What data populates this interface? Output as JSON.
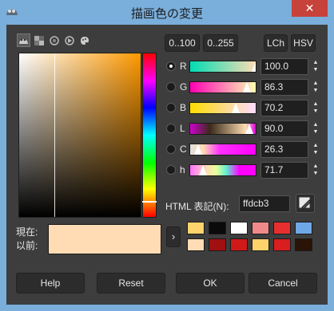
{
  "window": {
    "title": "描画色の変更",
    "close_glyph": "✕"
  },
  "tabs": [
    {
      "icon": "gimp-wilber-icon"
    },
    {
      "icon": "cmyk-selector-icon"
    },
    {
      "icon": "watercolor-icon"
    },
    {
      "icon": "wheel-icon"
    },
    {
      "icon": "palette-icon"
    }
  ],
  "range_buttons": {
    "range100": "0..100",
    "range255": "0..255"
  },
  "mode_buttons": {
    "lch": "LCh",
    "hsv": "HSV"
  },
  "channels": [
    {
      "key": "R",
      "label": "R",
      "value": "100.0",
      "selected": true,
      "marker_pct": 100
    },
    {
      "key": "G",
      "label": "G",
      "value": "86.3",
      "selected": false,
      "marker_pct": 86
    },
    {
      "key": "B",
      "label": "B",
      "value": "70.2",
      "selected": false,
      "marker_pct": 70
    },
    {
      "key": "L",
      "label": "L",
      "value": "90.0",
      "selected": false,
      "marker_pct": 90
    },
    {
      "key": "C",
      "label": "C",
      "value": "26.3",
      "selected": false,
      "marker_pct": 12
    },
    {
      "key": "h",
      "label": "h",
      "value": "71.7",
      "selected": false,
      "marker_pct": 20
    }
  ],
  "html_notation": {
    "label": "HTML 表記(N):",
    "value": "ffdcb3"
  },
  "color_preview": {
    "current_label": "現在:",
    "previous_label": "以前:",
    "current_color": "#ffdcb3"
  },
  "arrow_glyph": "›",
  "history": [
    "#ffd36b",
    "#0a0a0a",
    "#ffffff",
    "#f08a8a",
    "#e82f2f",
    "#6fa8e6",
    "#ffdcb3",
    "#a01010",
    "#d01a1a",
    "#ffd36b",
    "#d81e1e",
    "#2a1408"
  ],
  "buttons": {
    "help": "Help",
    "reset": "Reset",
    "ok": "OK",
    "cancel": "Cancel"
  }
}
